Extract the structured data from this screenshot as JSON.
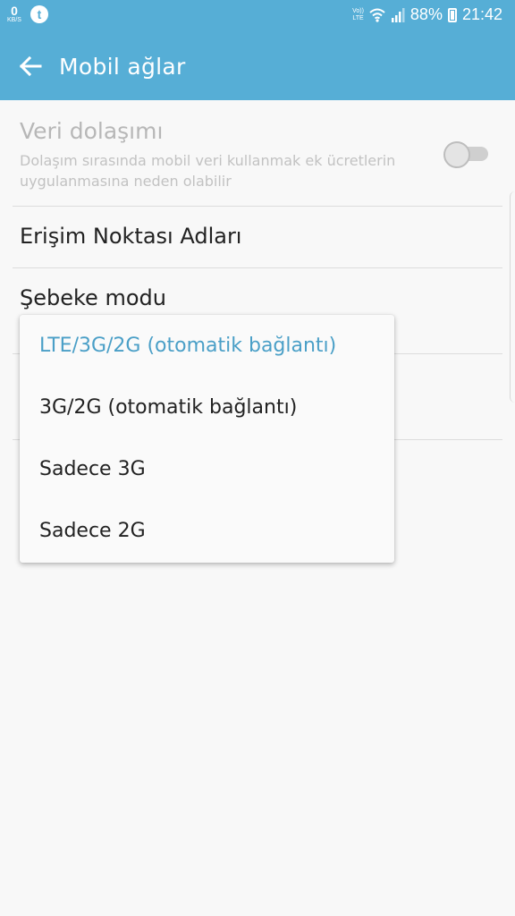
{
  "status_bar": {
    "net_speed": "0",
    "net_unit": "KB/S",
    "notification_letter": "t",
    "volte_top": "Vo))",
    "volte_bottom": "LTE",
    "battery": "88%",
    "time": "21:42"
  },
  "app_bar": {
    "title": "Mobil ağlar"
  },
  "settings": {
    "roaming_title": "Veri dolaşımı",
    "roaming_subtitle": "Dolaşım sırasında mobil veri kullanmak ek ücretlerin uygulanmasına neden olabilir",
    "roaming_enabled": false,
    "apn_title": "Erişim Noktası Adları",
    "network_mode_title": "Şebeke modu"
  },
  "network_mode_dropdown": {
    "selected_index": 0,
    "options": [
      "LTE/3G/2G (otomatik bağlantı)",
      "3G/2G (otomatik bağlantı)",
      "Sadece 3G",
      "Sadece 2G"
    ]
  },
  "colors": {
    "accent": "#56aed6",
    "selected_text": "#4a9fc7"
  },
  "icons": {
    "back": "arrow-left-icon",
    "wifi": "wifi-icon",
    "signal": "signal-icon",
    "battery": "battery-icon"
  }
}
